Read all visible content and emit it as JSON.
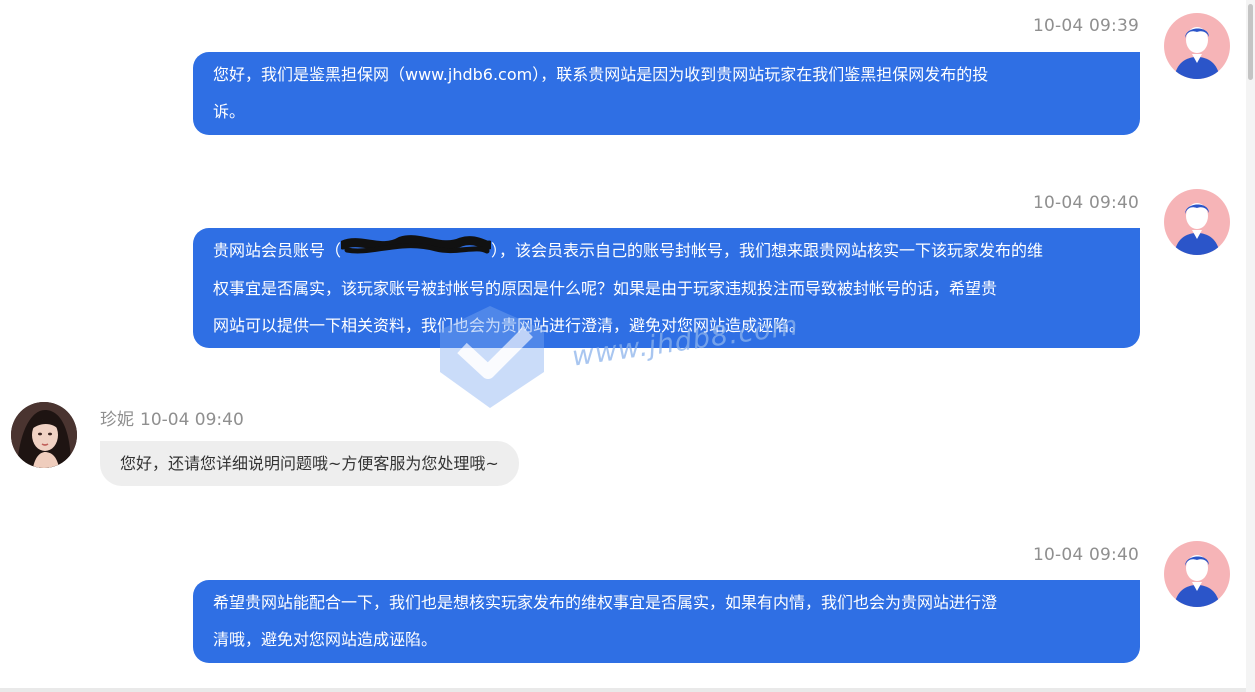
{
  "conversation": {
    "messages": [
      {
        "sender": "user",
        "time": "10-04 09:39",
        "lines": [
          "您好，我们是鉴黑担保网（www.jhdb6.com），联系贵网站是因为收到贵网站玩家在我们鉴黑担保网发布的投",
          "诉。"
        ]
      },
      {
        "sender": "user",
        "time": "10-04 09:40",
        "line1_pre": "贵网站会员账号（",
        "line1_post": "），该会员表示自己的账号封帐号，我们想来跟贵网站核实一下该玩家发布的维",
        "lines_rest": [
          "权事宜是否属实，该玩家账号被封帐号的原因是什么呢？如果是由于玩家违规投注而导致被封帐号的话，希望贵",
          "网站可以提供一下相关资料，我们也会为贵网站进行澄清，避免对您网站造成诬陷。"
        ]
      },
      {
        "sender": "agent",
        "name": "珍妮",
        "time": "10-04 09:40",
        "text": "您好，还请您详细说明问题哦~方便客服为您处理哦~"
      },
      {
        "sender": "user",
        "time": "10-04 09:40",
        "lines": [
          "希望贵网站能配合一下，我们也是想核实玩家发布的维权事宜是否属实，如果有内情，我们也会为贵网站进行澄",
          "清哦，避免对您网站造成诬陷。"
        ]
      }
    ]
  },
  "watermark": {
    "text": "www.jhdb8.com",
    "logo_icon": "shield-check-icon"
  },
  "colors": {
    "user_bubble": "#2f6fe4",
    "agent_bubble": "#eeeeee",
    "timestamp": "#8f8f8f",
    "user_avatar_bg": "#f6b4b7",
    "user_avatar_figure": "#2b55c9"
  }
}
